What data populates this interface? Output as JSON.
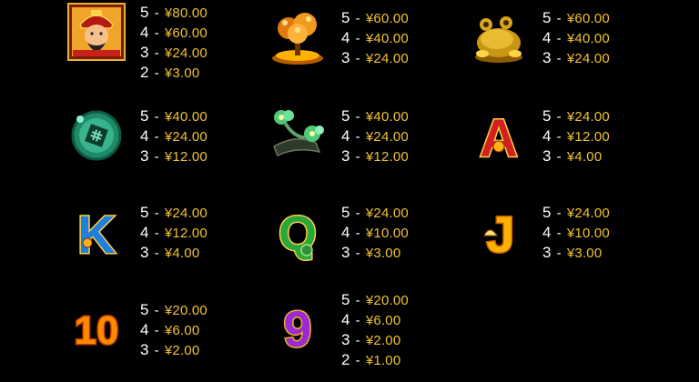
{
  "paytable": [
    {
      "symbol": "god-of-wealth",
      "pays": [
        {
          "count": "5",
          "amount": "¥80.00"
        },
        {
          "count": "4",
          "amount": "¥60.00"
        },
        {
          "count": "3",
          "amount": "¥24.00"
        },
        {
          "count": "2",
          "amount": "¥3.00"
        }
      ]
    },
    {
      "symbol": "money-tree",
      "pays": [
        {
          "count": "5",
          "amount": "¥60.00"
        },
        {
          "count": "4",
          "amount": "¥40.00"
        },
        {
          "count": "3",
          "amount": "¥24.00"
        }
      ]
    },
    {
      "symbol": "golden-toad",
      "pays": [
        {
          "count": "5",
          "amount": "¥60.00"
        },
        {
          "count": "4",
          "amount": "¥40.00"
        },
        {
          "count": "3",
          "amount": "¥24.00"
        }
      ]
    },
    {
      "symbol": "jade-coin",
      "pays": [
        {
          "count": "5",
          "amount": "¥40.00"
        },
        {
          "count": "4",
          "amount": "¥24.00"
        },
        {
          "count": "3",
          "amount": "¥12.00"
        }
      ]
    },
    {
      "symbol": "jade-ruyi",
      "pays": [
        {
          "count": "5",
          "amount": "¥40.00"
        },
        {
          "count": "4",
          "amount": "¥24.00"
        },
        {
          "count": "3",
          "amount": "¥12.00"
        }
      ]
    },
    {
      "symbol": "letter-a",
      "pays": [
        {
          "count": "5",
          "amount": "¥24.00"
        },
        {
          "count": "4",
          "amount": "¥12.00"
        },
        {
          "count": "3",
          "amount": "¥4.00"
        }
      ]
    },
    {
      "symbol": "letter-k",
      "pays": [
        {
          "count": "5",
          "amount": "¥24.00"
        },
        {
          "count": "4",
          "amount": "¥12.00"
        },
        {
          "count": "3",
          "amount": "¥4.00"
        }
      ]
    },
    {
      "symbol": "letter-q",
      "pays": [
        {
          "count": "5",
          "amount": "¥24.00"
        },
        {
          "count": "4",
          "amount": "¥10.00"
        },
        {
          "count": "3",
          "amount": "¥3.00"
        }
      ]
    },
    {
      "symbol": "letter-j",
      "pays": [
        {
          "count": "5",
          "amount": "¥24.00"
        },
        {
          "count": "4",
          "amount": "¥10.00"
        },
        {
          "count": "3",
          "amount": "¥3.00"
        }
      ]
    },
    {
      "symbol": "number-10",
      "pays": [
        {
          "count": "5",
          "amount": "¥20.00"
        },
        {
          "count": "4",
          "amount": "¥6.00"
        },
        {
          "count": "3",
          "amount": "¥2.00"
        }
      ]
    },
    {
      "symbol": "number-9",
      "pays": [
        {
          "count": "5",
          "amount": "¥20.00"
        },
        {
          "count": "4",
          "amount": "¥6.00"
        },
        {
          "count": "3",
          "amount": "¥2.00"
        },
        {
          "count": "2",
          "amount": "¥1.00"
        }
      ]
    }
  ],
  "separator": "-",
  "symbol_glyphs": {
    "a": "A",
    "k": "K",
    "q": "Q",
    "j": "J",
    "ten": "10",
    "nine": "9"
  },
  "colors": {
    "background": "#000000",
    "count": "#ffffff",
    "amount": "#f1c232"
  }
}
